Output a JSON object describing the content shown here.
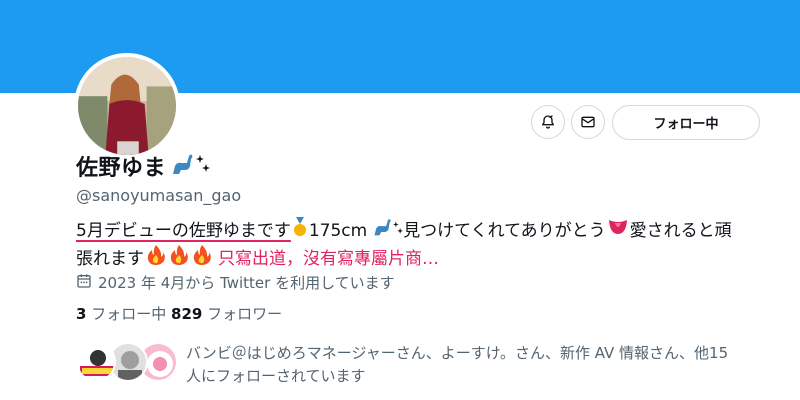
{
  "profile": {
    "display_name": "佐野ゆま",
    "handle": "@sanoyumasan_gao",
    "bio_part1": "5月デビューの佐野ゆまです",
    "bio_part2": "175cm",
    "bio_part3": "見つけてくれてありがとう",
    "bio_part4": "愛されると頑",
    "bio_part5": "張れます",
    "bio_part6": "只寫出道，沒有寫專屬片商…",
    "joined": "2023 年 4月から Twitter を利用しています"
  },
  "actions": {
    "follow_label": "フォロー中"
  },
  "stats": {
    "following_count": "3",
    "following_label": "フォロー中",
    "followers_count": "829",
    "followers_label": "フォロワー"
  },
  "followed_by": {
    "line1": "バンビ＠はじめろマネージャーさん、よーすけ。さん、新作 AV 情報さん、他15",
    "line2": "人にフォローされています"
  },
  "colors": {
    "banner": "#1d9bf0",
    "highlight_red": "#e0245e",
    "muted_text": "#536471"
  },
  "icons": [
    "notify-bell-icon",
    "mail-icon",
    "calendar-icon",
    "dinosaur-emoji",
    "sparkle-emoji",
    "medal-emoji",
    "tongue-emoji",
    "fire-emoji"
  ]
}
